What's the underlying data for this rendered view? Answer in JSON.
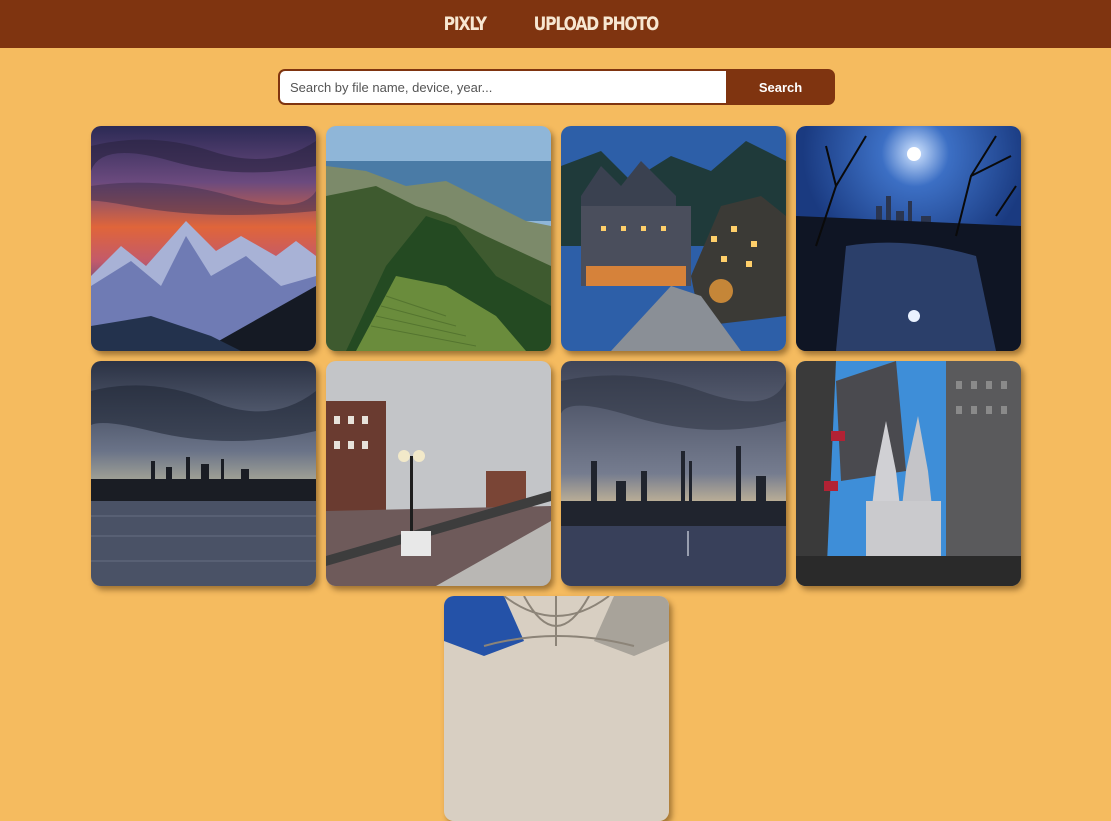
{
  "navbar": {
    "brand": "PIXLY",
    "upload_link": "UPLOAD PHOTO"
  },
  "search": {
    "placeholder": "Search by file name, device, year...",
    "value": "",
    "button_label": "Search"
  },
  "colors": {
    "page_background": "#f5bb5f",
    "navbar_background": "#7f3410",
    "accent": "#7f3410"
  },
  "gallery": {
    "photos": [
      {
        "subject": "snowy mountain range at sunset"
      },
      {
        "subject": "coastal hills with vineyards"
      },
      {
        "subject": "alpine village lit at dusk"
      },
      {
        "subject": "moonlit lake with bare trees and city skyline"
      },
      {
        "subject": "reservoir under cloudy sky with skyline"
      },
      {
        "subject": "waterfront promenade with lamp post"
      },
      {
        "subject": "city skyline over water on cloudy evening"
      },
      {
        "subject": "gothic cathedral among skyscrapers"
      },
      {
        "subject": "vaulted cathedral ceiling"
      }
    ]
  }
}
